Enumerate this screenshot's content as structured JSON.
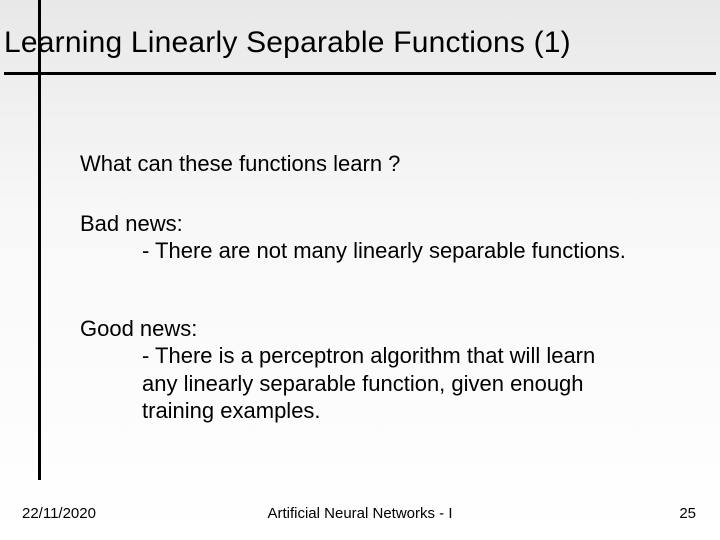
{
  "title": "Learning Linearly Separable Functions (1)",
  "body": {
    "question": "What can these functions learn ?",
    "bad": {
      "heading": "Bad news:",
      "line1": "- There are not many linearly separable functions."
    },
    "good": {
      "heading": "Good news:",
      "line1": "- There is a perceptron algorithm that will learn",
      "line2": "any linearly separable function, given enough",
      "line3": "training examples."
    }
  },
  "footer": {
    "date": "22/11/2020",
    "center": "Artificial Neural Networks - I",
    "page": "25"
  }
}
